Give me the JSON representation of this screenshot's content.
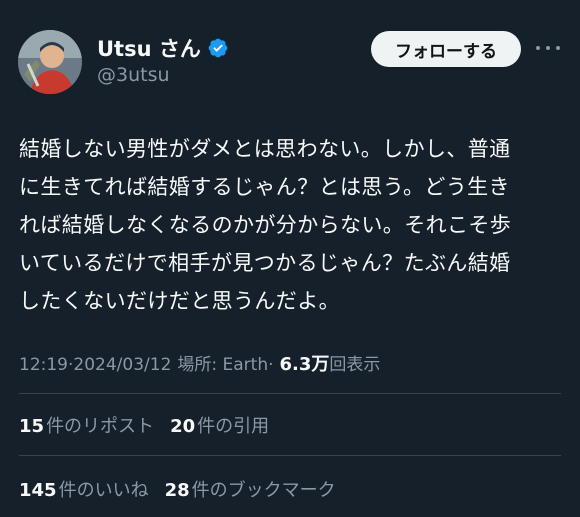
{
  "author": {
    "display_name": "Utsu さん",
    "handle": "@3utsu",
    "verified_icon": "verified-badge-icon",
    "verified_color": "#1d9bf0"
  },
  "follow_button": {
    "label": "フォローする"
  },
  "more_icon": "more-horizontal-icon",
  "tweet": {
    "lines": [
      "結婚しない男性がダメとは思わない。しかし、普通",
      "に生きてれば結婚するじゃん？とは思う。どう生き",
      "れば結婚しなくなるのかが分からない。それこそ歩",
      "いているだけで相手が見つかるじゃん？たぶん結婚",
      "したくないだけだと思うんだよ。"
    ]
  },
  "meta": {
    "time": "12:19",
    "separator": " · ",
    "date": "2024/03/12",
    "location": "場所: Earth",
    "views_count": "6.3万",
    "views_label": "回表示"
  },
  "stats": {
    "reposts": {
      "count": "15",
      "label": "件のリポスト"
    },
    "quotes": {
      "count": "20",
      "label": "件の引用"
    },
    "likes": {
      "count": "145",
      "label": "件のいいね"
    },
    "bookmarks": {
      "count": "28",
      "label": "件のブックマーク"
    }
  },
  "colors": {
    "background": "#15202b",
    "text": "#f7f9f9",
    "muted": "#8b98a5",
    "divider": "#38444d",
    "button_bg": "#eff3f4"
  }
}
